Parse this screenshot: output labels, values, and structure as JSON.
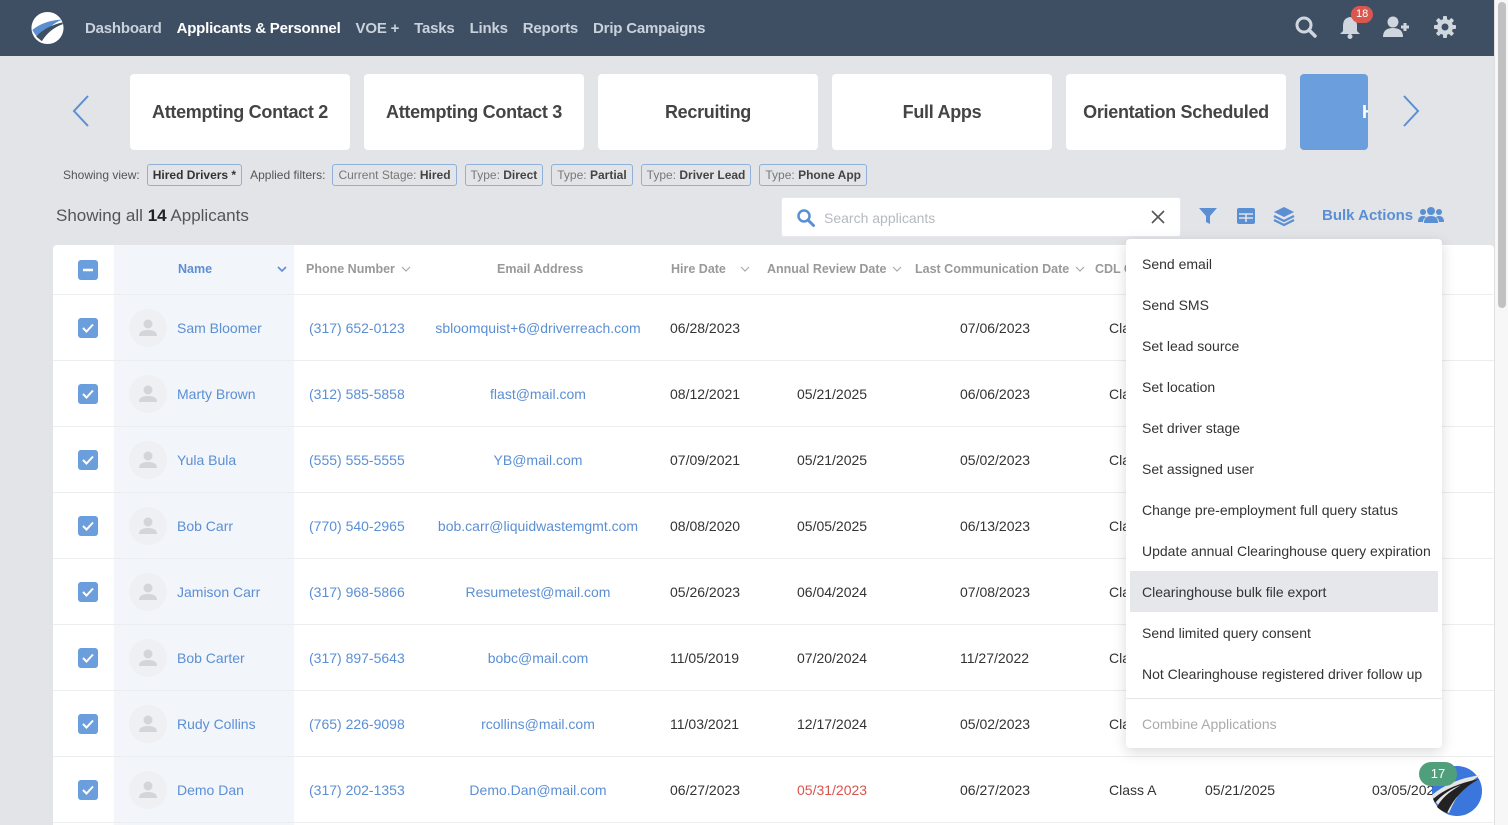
{
  "nav": {
    "items": [
      {
        "label": "Dashboard",
        "active": false
      },
      {
        "label": "Applicants & Personnel",
        "active": true
      },
      {
        "label": "VOE +",
        "active": false
      },
      {
        "label": "Tasks",
        "active": false
      },
      {
        "label": "Links",
        "active": false
      },
      {
        "label": "Reports",
        "active": false
      },
      {
        "label": "Drip Campaigns",
        "active": false
      }
    ],
    "notification_count": "18",
    "icons": [
      "search-icon",
      "bell-icon",
      "add-user-icon",
      "gear-icon"
    ]
  },
  "stages": {
    "cards": [
      {
        "label": "Attempting Contact 2"
      },
      {
        "label": "Attempting Contact 3"
      },
      {
        "label": "Recruiting"
      },
      {
        "label": "Full Apps"
      },
      {
        "label": "Orientation Scheduled"
      },
      {
        "label": "H",
        "active": true
      }
    ]
  },
  "filters": {
    "view_label": "Showing view:",
    "view_value": "Hired Drivers *",
    "applied_label": "Applied filters:",
    "chips": [
      {
        "key": "Current Stage:",
        "value": "Hired"
      },
      {
        "key": "Type:",
        "value": "Direct"
      },
      {
        "key": "Type:",
        "value": "Partial"
      },
      {
        "key": "Type:",
        "value": "Driver Lead"
      },
      {
        "key": "Type:",
        "value": "Phone App"
      }
    ]
  },
  "summary": {
    "prefix": "Showing all",
    "count": "14",
    "suffix": "Applicants"
  },
  "search": {
    "placeholder": "Search applicants",
    "value": ""
  },
  "toolbar": {
    "bulk_actions_label": "Bulk Actions"
  },
  "table": {
    "columns": [
      "Name",
      "Phone Number",
      "Email Address",
      "Hire Date",
      "Annual Review Date",
      "Last Communication Date",
      "CDL C"
    ],
    "rows": [
      {
        "name": "Sam Bloomer",
        "phone": "(317) 652-0123",
        "email": "sbloomquist+6@driverreach.com",
        "hire": "06/28/2023",
        "review": "",
        "review_overdue": false,
        "last_comm": "07/06/2023",
        "cdl": "Cla",
        "checked": true
      },
      {
        "name": "Marty Brown",
        "phone": "(312) 585-5858",
        "email": "flast@mail.com",
        "hire": "08/12/2021",
        "review": "05/21/2025",
        "review_overdue": false,
        "last_comm": "06/06/2023",
        "cdl": "Cla",
        "checked": true
      },
      {
        "name": "Yula Bula",
        "phone": "(555) 555-5555",
        "email": "YB@mail.com",
        "hire": "07/09/2021",
        "review": "05/21/2025",
        "review_overdue": false,
        "last_comm": "05/02/2023",
        "cdl": "Cla",
        "checked": true
      },
      {
        "name": "Bob Carr",
        "phone": "(770) 540-2965",
        "email": "bob.carr@liquidwastemgmt.com",
        "hire": "08/08/2020",
        "review": "05/05/2025",
        "review_overdue": false,
        "last_comm": "06/13/2023",
        "cdl": "Cla",
        "checked": true
      },
      {
        "name": "Jamison Carr",
        "phone": "(317) 968-5866",
        "email": "Resumetest@mail.com",
        "hire": "05/26/2023",
        "review": "06/04/2024",
        "review_overdue": false,
        "last_comm": "07/08/2023",
        "cdl": "Cla",
        "checked": true
      },
      {
        "name": "Bob Carter",
        "phone": "(317) 897-5643",
        "email": "bobc@mail.com",
        "hire": "11/05/2019",
        "review": "07/20/2024",
        "review_overdue": false,
        "last_comm": "11/27/2022",
        "cdl": "Cla",
        "checked": true
      },
      {
        "name": "Rudy Collins",
        "phone": "(765) 226-9098",
        "email": "rcollins@mail.com",
        "hire": "11/03/2021",
        "review": "12/17/2024",
        "review_overdue": false,
        "last_comm": "05/02/2023",
        "cdl": "Cla",
        "checked": true
      },
      {
        "name": "Demo Dan",
        "phone": "(317) 202-1353",
        "email": "Demo.Dan@mail.com",
        "hire": "06/27/2023",
        "review": "05/31/2023",
        "review_overdue": true,
        "last_comm": "06/27/2023",
        "cdl": "Class A",
        "extra1": "05/21/2025",
        "extra2": "03/05/202",
        "checked": true
      }
    ]
  },
  "bulk_menu": {
    "items": [
      {
        "label": "Send email"
      },
      {
        "label": "Send SMS"
      },
      {
        "label": "Set lead source"
      },
      {
        "label": "Set location"
      },
      {
        "label": "Set driver stage"
      },
      {
        "label": "Set assigned user"
      },
      {
        "label": "Change pre-employment full query status"
      },
      {
        "label": "Update annual Clearinghouse query expiration"
      },
      {
        "label": "Clearinghouse bulk file export",
        "hovered": true
      },
      {
        "label": "Send limited query consent"
      },
      {
        "label": "Not Clearinghouse registered driver follow up"
      }
    ],
    "disabled_item": "Combine Applications"
  },
  "chat": {
    "badge_count": "17"
  },
  "colors": {
    "nav_bg": "#3f4f63",
    "accent": "#6b9edc",
    "link": "#5b8fd4",
    "overdue": "#d9534f",
    "badge_red": "#d9574f",
    "badge_green": "#4fa07a"
  }
}
